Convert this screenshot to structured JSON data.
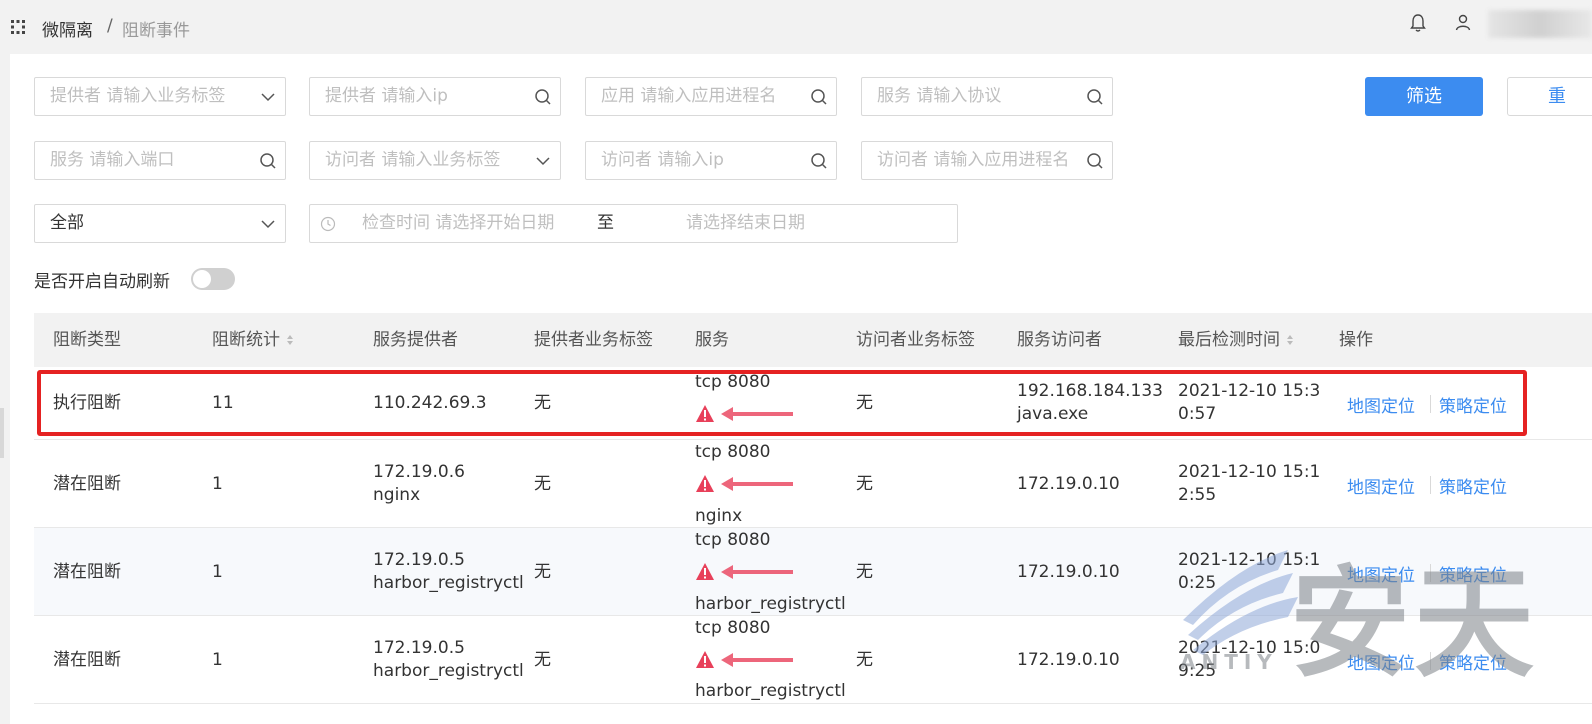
{
  "breadcrumb": {
    "root": "微隔离",
    "separator": "/",
    "current": "阻断事件"
  },
  "filters": {
    "provider_tag": "提供者 请输入业务标签",
    "provider_ip": "提供者 请输入ip",
    "app_process": "应用 请输入应用进程名",
    "service_protocol": "服务 请输入协议",
    "service_port": "服务 请输入端口",
    "visitor_tag": "访问者 请输入业务标签",
    "visitor_ip": "访问者 请输入ip",
    "visitor_process": "访问者 请输入应用进程名",
    "type_select": "全部",
    "date_start": "检查时间 请选择开始日期",
    "date_to": "至",
    "date_end": "请选择结束日期",
    "filter_button": "筛选",
    "reset_button": "重"
  },
  "auto_refresh_label": "是否开启自动刷新",
  "auto_refresh_on": false,
  "table": {
    "headers": [
      "阻断类型",
      "阻断统计",
      "服务提供者",
      "提供者业务标签",
      "服务",
      "访问者业务标签",
      "服务访问者",
      "最后检测时间",
      "操作"
    ],
    "rows": [
      {
        "type": "执行阻断",
        "count": "11",
        "provider_ip": "110.242.69.3",
        "provider_name": "",
        "provider_tag": "无",
        "service": "tcp  8080",
        "service_name": "",
        "visitor_tag": "无",
        "visitor_ip": "192.168.184.133",
        "visitor_name": "java.exe",
        "time_1": "2021-12-10 15:3",
        "time_2": "0:57",
        "action_map": "地图定位",
        "action_policy": "策略定位"
      },
      {
        "type": "潜在阻断",
        "count": "1",
        "provider_ip": "172.19.0.6",
        "provider_name": "nginx",
        "provider_tag": "无",
        "service": "tcp  8080",
        "service_name": "nginx",
        "visitor_tag": "无",
        "visitor_ip": "172.19.0.10",
        "visitor_name": "",
        "time_1": "2021-12-10 15:1",
        "time_2": "2:55",
        "action_map": "地图定位",
        "action_policy": "策略定位"
      },
      {
        "type": "潜在阻断",
        "count": "1",
        "provider_ip": "172.19.0.5",
        "provider_name": "harbor_registryctl",
        "provider_tag": "无",
        "service": "tcp  8080",
        "service_name": "harbor_registryctl",
        "visitor_tag": "无",
        "visitor_ip": "172.19.0.10",
        "visitor_name": "",
        "time_1": "2021-12-10 15:1",
        "time_2": "0:25",
        "action_map": "地图定位",
        "action_policy": "策略定位"
      },
      {
        "type": "潜在阻断",
        "count": "1",
        "provider_ip": "172.19.0.5",
        "provider_name": "harbor_registryctl",
        "provider_tag": "无",
        "service": "tcp  8080",
        "service_name": "harbor_registryctl",
        "visitor_tag": "无",
        "visitor_ip": "172.19.0.10",
        "visitor_name": "",
        "time_1": "2021-12-10 15:0",
        "time_2": "9:25",
        "action_map": "地图定位",
        "action_policy": "策略定位"
      }
    ]
  },
  "watermark": {
    "text": "安天",
    "sub": "ANTIY"
  },
  "colors": {
    "primary": "#3c8cf0",
    "highlight": "#e52222",
    "warning": "#e8405a"
  }
}
